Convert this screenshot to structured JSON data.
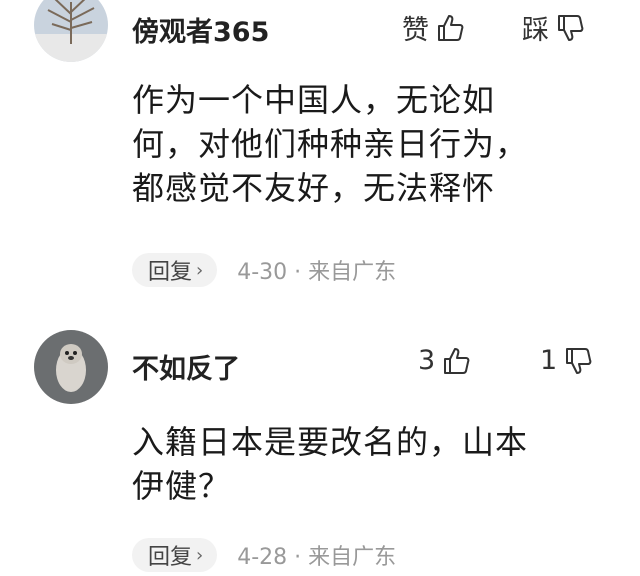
{
  "comments": [
    {
      "username": "傍观者365",
      "like_label": "赞",
      "like_icon": "thumbs-up-icon",
      "dislike_label": "踩",
      "dislike_icon": "thumbs-down-icon",
      "text_lines": [
        "作为一个中国人，无论如",
        "何，对他们种种亲日行为，",
        "都感觉不友好，无法释怀"
      ],
      "reply_label": "回复",
      "reply_chevron": "›",
      "date": "4-30",
      "location": "来自广东",
      "meta": "4-30 · 来自广东"
    },
    {
      "username": "不如反了",
      "like_label": "3",
      "like_icon": "thumbs-up-icon",
      "dislike_label": "1",
      "dislike_icon": "thumbs-down-icon",
      "text_lines": [
        "入籍日本是要改名的，山本",
        "伊健？"
      ],
      "reply_label": "回复",
      "reply_chevron": "›",
      "date": "4-28",
      "location": "来自广东",
      "meta": "4-28 · 来自广东"
    }
  ]
}
